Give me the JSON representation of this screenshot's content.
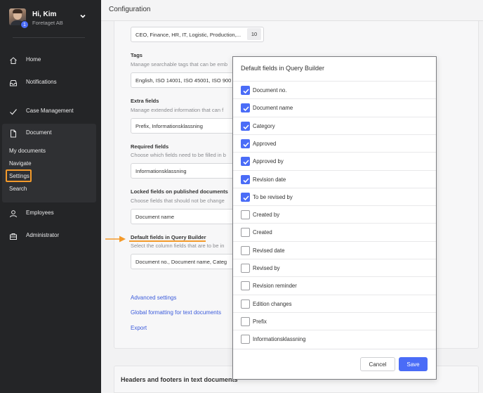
{
  "user": {
    "greeting": "Hi, Kim",
    "org": "Foretaget AB",
    "badge": "1"
  },
  "sidebar": {
    "items": [
      {
        "label": "Home",
        "icon": "home-icon"
      },
      {
        "label": "Notifications",
        "icon": "inbox-icon"
      },
      {
        "label": "Case Management",
        "icon": "check-icon"
      },
      {
        "label": "Document",
        "icon": "document-icon"
      },
      {
        "label": "Employees",
        "icon": "person-icon"
      },
      {
        "label": "Administrator",
        "icon": "briefcase-icon"
      }
    ],
    "document_sub": [
      "My documents",
      "Navigate",
      "Settings",
      "Search"
    ]
  },
  "header": {
    "title": "Configuration"
  },
  "main": {
    "categories_value": "CEO, Finance, HR, IT, Logistic, Production,...",
    "categories_count": "10",
    "tags": {
      "title": "Tags",
      "desc": "Manage searchable tags that can be emb",
      "value": "English, ISO 14001, ISO 45001, ISO 900"
    },
    "extra": {
      "title": "Extra fields",
      "desc": "Manage extended information that can f",
      "value": "Prefix, Informationsklassning"
    },
    "required": {
      "title": "Required fields",
      "desc": "Choose which fields need to be filled in b",
      "value": "Informationsklassning"
    },
    "locked": {
      "title": "Locked fields on published documents",
      "desc": "Choose fields that should not be change",
      "value": "Document name"
    },
    "default": {
      "title": "Default fields in Query Builder",
      "desc": "Select the column fields that are to be in",
      "value": "Document no., Document name, Categ"
    },
    "links": [
      "Advanced settings",
      "Global formatting for text documents",
      "Export"
    ],
    "headers_footers": "Headers and footers in text documents"
  },
  "modal": {
    "title": "Default fields in Query Builder",
    "options": [
      {
        "label": "Document no.",
        "checked": true
      },
      {
        "label": "Document name",
        "checked": true
      },
      {
        "label": "Category",
        "checked": true
      },
      {
        "label": "Approved",
        "checked": true
      },
      {
        "label": "Approved by",
        "checked": true
      },
      {
        "label": "Revision date",
        "checked": true
      },
      {
        "label": "To be revised by",
        "checked": true
      },
      {
        "label": "Created by",
        "checked": false
      },
      {
        "label": "Created",
        "checked": false
      },
      {
        "label": "Revised date",
        "checked": false
      },
      {
        "label": "Revised by",
        "checked": false
      },
      {
        "label": "Revision reminder",
        "checked": false
      },
      {
        "label": "Edition changes",
        "checked": false
      },
      {
        "label": "Prefix",
        "checked": false
      },
      {
        "label": "Informationsklassning",
        "checked": false
      }
    ],
    "cancel_label": "Cancel",
    "save_label": "Save"
  },
  "colors": {
    "accent": "#4a6cf7",
    "highlight": "#f39a2b",
    "sidebar_bg": "#242527"
  }
}
